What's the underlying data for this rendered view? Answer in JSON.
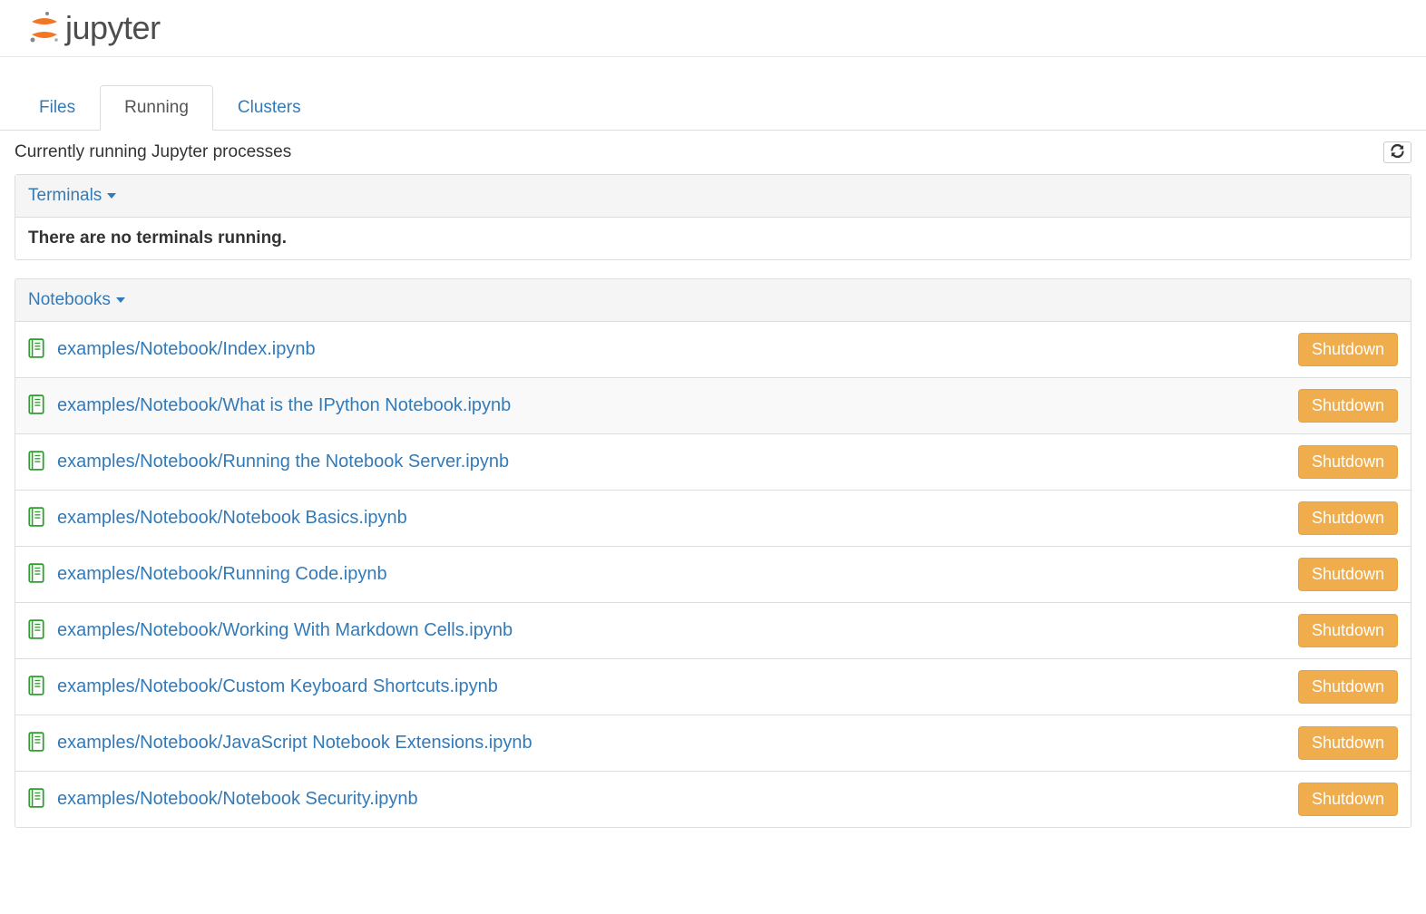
{
  "logo_text": "jupyter",
  "tabs": {
    "files": "Files",
    "running": "Running",
    "clusters": "Clusters"
  },
  "subtitle": "Currently running Jupyter processes",
  "terminals": {
    "heading": "Terminals",
    "empty_message": "There are no terminals running."
  },
  "notebooks": {
    "heading": "Notebooks",
    "shutdown_label": "Shutdown",
    "items": [
      {
        "path": "examples/Notebook/Index.ipynb"
      },
      {
        "path": "examples/Notebook/What is the IPython Notebook.ipynb"
      },
      {
        "path": "examples/Notebook/Running the Notebook Server.ipynb"
      },
      {
        "path": "examples/Notebook/Notebook Basics.ipynb"
      },
      {
        "path": "examples/Notebook/Running Code.ipynb"
      },
      {
        "path": "examples/Notebook/Working With Markdown Cells.ipynb"
      },
      {
        "path": "examples/Notebook/Custom Keyboard Shortcuts.ipynb"
      },
      {
        "path": "examples/Notebook/JavaScript Notebook Extensions.ipynb"
      },
      {
        "path": "examples/Notebook/Notebook Security.ipynb"
      }
    ]
  }
}
